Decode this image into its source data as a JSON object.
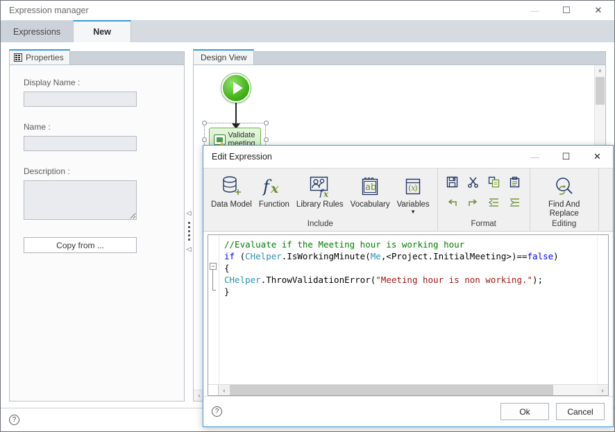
{
  "main_window": {
    "title": "Expression manager",
    "controls": [
      {
        "name": "minimize",
        "glyph": "—",
        "state": "disabled"
      },
      {
        "name": "maximize",
        "glyph": "☐",
        "state": "enabled"
      },
      {
        "name": "close",
        "glyph": "✕",
        "state": "enabled"
      }
    ],
    "tabs": [
      {
        "label": "Expressions",
        "active": false
      },
      {
        "label": "New",
        "active": true
      }
    ],
    "footer": {
      "help_icon": "help-icon",
      "help_glyph": "?"
    }
  },
  "properties_panel": {
    "tab_label": "Properties",
    "tab_icon": "properties-grid-icon",
    "fields": [
      {
        "label": "Display Name :",
        "value": "",
        "placeholder": ""
      },
      {
        "label": "Name :",
        "value": "",
        "placeholder": ""
      },
      {
        "label": "Description :",
        "value": "",
        "placeholder": ""
      }
    ],
    "copy_from_label": "Copy from ..."
  },
  "splitter": {
    "collapse_left_glyph": "◁",
    "collapse_right_glyph": "◁"
  },
  "design_view": {
    "tab_label": "Design View",
    "nodes": [
      {
        "type": "start",
        "name": "start-node",
        "label": ""
      },
      {
        "type": "task",
        "name": "validate-meeting-node",
        "label": "Validate meeting",
        "selected": true,
        "has_warning": true
      }
    ],
    "scroll": {
      "up_glyph": "˄",
      "down_glyph": "˅",
      "left_glyph": "‹",
      "right_glyph": "›"
    }
  },
  "dialog": {
    "title": "Edit Expression",
    "controls": [
      {
        "name": "minimize",
        "glyph": "—",
        "state": "disabled"
      },
      {
        "name": "maximize",
        "glyph": "☐",
        "state": "enabled"
      },
      {
        "name": "close",
        "glyph": "✕",
        "state": "enabled"
      }
    ],
    "ribbon": {
      "groups": [
        {
          "label": "Include",
          "buttons": [
            {
              "label": "Data Model",
              "icon": "database-add-icon",
              "has_caret": false
            },
            {
              "label": "Function",
              "icon": "fx-icon",
              "has_caret": false
            },
            {
              "label": "Library Rules",
              "icon": "library-rules-icon",
              "has_caret": false
            },
            {
              "label": "Vocabulary",
              "icon": "vocabulary-notepad-icon",
              "has_caret": false
            },
            {
              "label": "Variables",
              "icon": "variables-icon",
              "has_caret": true
            }
          ]
        },
        {
          "label": "Format",
          "small_buttons": [
            {
              "name": "save-button",
              "icon": "save-floppy-icon"
            },
            {
              "name": "cut-button",
              "icon": "scissors-icon"
            },
            {
              "name": "copy-button",
              "icon": "copy-icon"
            },
            {
              "name": "paste-button",
              "icon": "paste-clipboard-icon"
            },
            {
              "name": "undo-button",
              "icon": "undo-arrow-icon"
            },
            {
              "name": "redo-button",
              "icon": "redo-arrow-icon"
            },
            {
              "name": "outdent-button",
              "icon": "outdent-icon"
            },
            {
              "name": "indent-button",
              "icon": "indent-icon"
            }
          ]
        },
        {
          "label": "Editing",
          "buttons": [
            {
              "label": "Find And Replace",
              "icon": "find-replace-magnifier-icon",
              "has_caret": false
            }
          ]
        }
      ]
    },
    "editor": {
      "fold_marker": "−",
      "lines": [
        [
          {
            "t": "//Evaluate if the Meeting hour is working hour",
            "c": "c-comment"
          }
        ],
        [
          {
            "t": "if ",
            "c": "c-key"
          },
          {
            "t": "(",
            "c": "c-punct"
          },
          {
            "t": "CHelper",
            "c": "c-type"
          },
          {
            "t": ".",
            "c": "c-punct"
          },
          {
            "t": "IsWorkingMinute",
            "c": "c-ident"
          },
          {
            "t": "(",
            "c": "c-punct"
          },
          {
            "t": "Me",
            "c": "c-type"
          },
          {
            "t": ",<Project.InitialMeeting>)==",
            "c": "c-punct"
          },
          {
            "t": "false",
            "c": "c-key"
          },
          {
            "t": ")",
            "c": "c-punct"
          }
        ],
        [
          {
            "t": "{",
            "c": "c-punct"
          }
        ],
        [
          {
            "t": "CHelper",
            "c": "c-type"
          },
          {
            "t": ".",
            "c": "c-punct"
          },
          {
            "t": "ThrowValidationError",
            "c": "c-ident"
          },
          {
            "t": "(",
            "c": "c-punct"
          },
          {
            "t": "\"Meeting hour is non working.\"",
            "c": "c-string"
          },
          {
            "t": ");",
            "c": "c-punct"
          }
        ],
        [
          {
            "t": "}",
            "c": "c-punct"
          }
        ]
      ],
      "hscroll": {
        "left_glyph": "‹",
        "right_glyph": "›"
      }
    },
    "footer": {
      "help_icon": "help-icon",
      "help_glyph": "?",
      "ok_label": "Ok",
      "cancel_label": "Cancel"
    }
  },
  "colors": {
    "accent": "#3b9ad9",
    "tab_strip": "#d6dbe2",
    "ribbon_bg": "#f0f0f0",
    "icon_navy": "#1f3864",
    "icon_green": "#6f9030",
    "comment_green": "#008000",
    "keyword_blue": "#0000ff",
    "type_teal": "#2b91af",
    "string_red": "#a31515"
  }
}
